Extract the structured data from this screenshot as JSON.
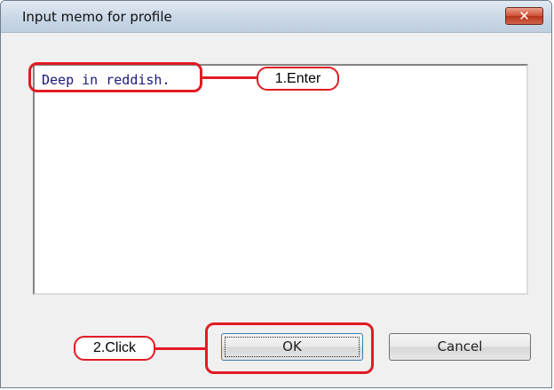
{
  "window": {
    "title": "Input memo for profile",
    "close_glyph": "✕"
  },
  "memo": {
    "value": "Deep in reddish."
  },
  "buttons": {
    "ok_label": "OK",
    "cancel_label": "Cancel"
  },
  "annotations": {
    "step1": "1.Enter",
    "step2": "2.Click",
    "color": "#e11b24"
  }
}
